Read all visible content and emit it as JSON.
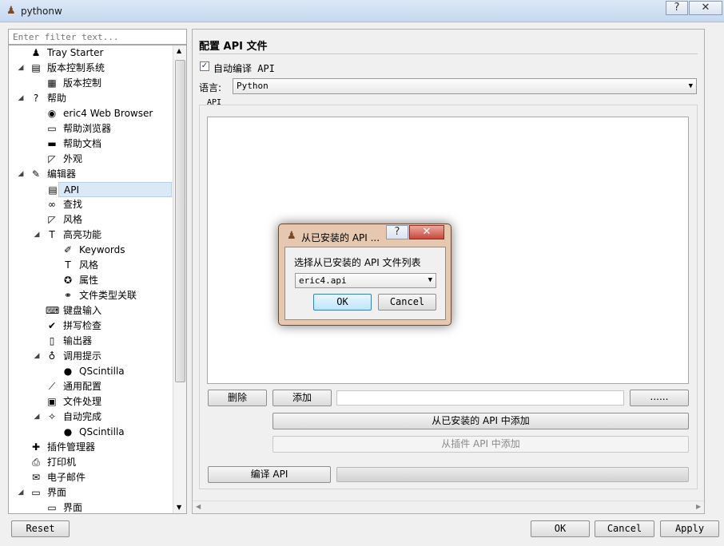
{
  "window": {
    "title": "pythonw"
  },
  "titlebar_buttons": {
    "help": "?",
    "close": "✕"
  },
  "filter": {
    "placeholder": "Enter filter text..."
  },
  "tree": [
    {
      "label": "Tray Starter",
      "level": 1,
      "icon": "person-icon",
      "arrow": ""
    },
    {
      "label": "版本控制系统",
      "level": 1,
      "icon": "database-icon",
      "arrow": "◢"
    },
    {
      "label": "版本控制",
      "level": 2,
      "icon": "vcs-icon",
      "arrow": ""
    },
    {
      "label": "帮助",
      "level": 1,
      "icon": "help-icon",
      "arrow": "◢"
    },
    {
      "label": "eric4 Web Browser",
      "level": 2,
      "icon": "browser-icon",
      "arrow": ""
    },
    {
      "label": "帮助浏览器",
      "level": 2,
      "icon": "help-browser-icon",
      "arrow": ""
    },
    {
      "label": "帮助文档",
      "level": 2,
      "icon": "help-docs-icon",
      "arrow": ""
    },
    {
      "label": "外观",
      "level": 2,
      "icon": "appearance-icon",
      "arrow": ""
    },
    {
      "label": "编辑器",
      "level": 1,
      "icon": "editor-icon",
      "arrow": "◢"
    },
    {
      "label": "API",
      "level": 2,
      "icon": "api-icon",
      "arrow": "",
      "selected": true
    },
    {
      "label": "查找",
      "level": 2,
      "icon": "find-icon",
      "arrow": ""
    },
    {
      "label": "风格",
      "level": 2,
      "icon": "style-icon",
      "arrow": ""
    },
    {
      "label": "高亮功能",
      "level": 2,
      "icon": "highlight-icon",
      "arrow": "◢"
    },
    {
      "label": "Keywords",
      "level": 3,
      "icon": "keywords-icon",
      "arrow": ""
    },
    {
      "label": "风格",
      "level": 3,
      "icon": "font-icon",
      "arrow": ""
    },
    {
      "label": "属性",
      "level": 3,
      "icon": "properties-icon",
      "arrow": ""
    },
    {
      "label": "文件类型关联",
      "level": 3,
      "icon": "filetypes-icon",
      "arrow": ""
    },
    {
      "label": "键盘输入",
      "level": 2,
      "icon": "keyboard-icon",
      "arrow": ""
    },
    {
      "label": "拼写检查",
      "level": 2,
      "icon": "spellcheck-icon",
      "arrow": ""
    },
    {
      "label": "输出器",
      "level": 2,
      "icon": "exporter-icon",
      "arrow": ""
    },
    {
      "label": "调用提示",
      "level": 2,
      "icon": "calltips-icon",
      "arrow": "◢"
    },
    {
      "label": "QScintilla",
      "level": 3,
      "icon": "qscintilla-icon",
      "arrow": ""
    },
    {
      "label": "通用配置",
      "level": 2,
      "icon": "general-icon",
      "arrow": ""
    },
    {
      "label": "文件处理",
      "level": 2,
      "icon": "filehandling-icon",
      "arrow": ""
    },
    {
      "label": "自动完成",
      "level": 2,
      "icon": "autocomplete-icon",
      "arrow": "◢"
    },
    {
      "label": "QScintilla",
      "level": 3,
      "icon": "qscintilla-icon",
      "arrow": ""
    },
    {
      "label": "插件管理器",
      "level": 1,
      "icon": "plugins-icon",
      "arrow": ""
    },
    {
      "label": "打印机",
      "level": 1,
      "icon": "printer-icon",
      "arrow": ""
    },
    {
      "label": "电子邮件",
      "level": 1,
      "icon": "email-icon",
      "arrow": ""
    },
    {
      "label": "界面",
      "level": 1,
      "icon": "interface-icon",
      "arrow": "◢"
    },
    {
      "label": "界面",
      "level": 2,
      "icon": "interface-icon",
      "arrow": ""
    }
  ],
  "icons": {
    "person-icon": "♟",
    "database-icon": "▤",
    "vcs-icon": "▦",
    "help-icon": "?",
    "browser-icon": "◉",
    "help-browser-icon": "▭",
    "help-docs-icon": "▬",
    "appearance-icon": "◸",
    "editor-icon": "✎",
    "api-icon": "▤",
    "find-icon": "∞",
    "style-icon": "◸",
    "highlight-icon": "T",
    "keywords-icon": "✐",
    "font-icon": "T",
    "properties-icon": "✪",
    "filetypes-icon": "⚭",
    "keyboard-icon": "⌨",
    "spellcheck-icon": "✔",
    "exporter-icon": "▯",
    "calltips-icon": "♁",
    "qscintilla-icon": "●",
    "general-icon": "⟋",
    "filehandling-icon": "▣",
    "autocomplete-icon": "✧",
    "plugins-icon": "✚",
    "printer-icon": "⎙",
    "email-icon": "✉",
    "interface-icon": "▭"
  },
  "page": {
    "title": "配置 API 文件",
    "auto_compile_label": "自动编译 API",
    "auto_compile_checked": true,
    "language_label": "语言:",
    "language_value": "Python",
    "api_group_label": "API",
    "delete_button": "删除",
    "add_button": "添加",
    "add_path_value": "",
    "browse_button": "......",
    "add_installed_button": "从已安装的 API 中添加",
    "add_plugin_button": "从插件 API 中添加",
    "compile_button": "编译 API"
  },
  "footer": {
    "reset": "Reset",
    "ok": "OK",
    "cancel": "Cancel",
    "apply": "Apply"
  },
  "dialog": {
    "title": "从已安装的 API ...",
    "help": "?",
    "close": "✕",
    "label": "选择从已安装的 API 文件列表",
    "selected": "eric4.api",
    "ok": "OK",
    "cancel": "Cancel"
  }
}
